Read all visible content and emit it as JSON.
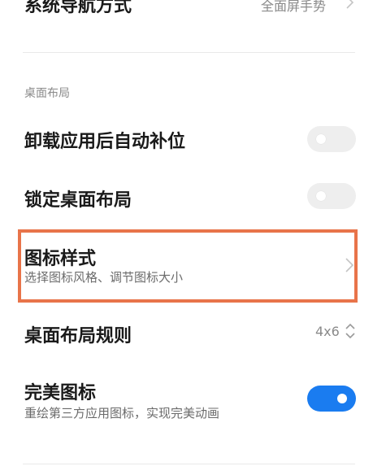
{
  "top_row": {
    "title": "系统导航方式",
    "value": "全面屏手势"
  },
  "section": {
    "header": "桌面布局"
  },
  "rows": {
    "auto_fill": {
      "title": "卸载应用后自动补位",
      "enabled": false
    },
    "lock_layout": {
      "title": "锁定桌面布局",
      "enabled": false
    },
    "icon_style": {
      "title": "图标样式",
      "subtitle": "选择图标风格、调节图标大小"
    },
    "layout_rule": {
      "title": "桌面布局规则",
      "value": "4x6"
    },
    "perfect_icon": {
      "title": "完美图标",
      "subtitle": "重绘第三方应用图标，实现完美动画",
      "enabled": true
    }
  },
  "colors": {
    "accent": "#1a7cf0",
    "highlight": "#e8744a",
    "toggle_off": "#eeeeee"
  }
}
